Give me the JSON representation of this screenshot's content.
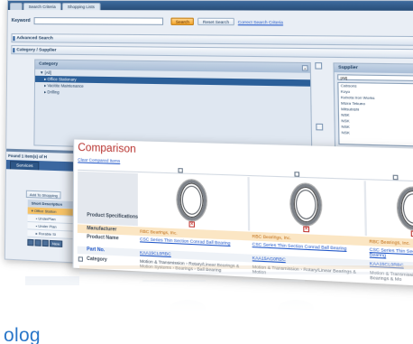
{
  "tabs": [
    "",
    "Search Criteria",
    "Shopping Lists"
  ],
  "search": {
    "keyword_label": "Keyword",
    "keyword_value": "",
    "search_button": "Search",
    "reset_button": "Reset Search",
    "correct_link": "Correct Search Criteria"
  },
  "sections": {
    "advanced": "Advanced Search",
    "category_supplier": "Category / Supplier"
  },
  "category": {
    "header": "Category",
    "items": [
      {
        "label": "▼ [All]",
        "selected": false,
        "indent": false
      },
      {
        "label": "▸ Office Stationary",
        "selected": true,
        "indent": true
      },
      {
        "label": "▸ Vacitite Maintenance",
        "selected": false,
        "indent": true
      },
      {
        "label": "▸ Drilling",
        "selected": false,
        "indent": true
      }
    ]
  },
  "supplier": {
    "header": "Supplier",
    "selected": "[All]",
    "items": [
      "Cabsons",
      "Koyo",
      "Kubota Iron Works",
      "Mizra Tekuno",
      "Mitsubishi",
      "NSK",
      "NSK",
      "NSK",
      "NSK"
    ]
  },
  "results": {
    "found_text": "Found 1 item(s) of H",
    "services_tab": "Services",
    "add_button": "Add To Shopping",
    "list_rows": [
      {
        "label": "Short Description",
        "type": "hd"
      },
      {
        "label": "▾ Office Station",
        "type": "sel"
      },
      {
        "label": "• UnderPlan",
        "type": "ind"
      },
      {
        "label": "• Under Plan",
        "type": "ind"
      },
      {
        "label": "▸ Rorable Si",
        "type": "ind"
      }
    ],
    "new_button": "New"
  },
  "comparison": {
    "title": "Comparison",
    "clear_link": "Clear Compared Items",
    "row_labels": {
      "product_specs": "Product Specifications",
      "manufacturer": "Manufacturer",
      "product_name": "Product Name",
      "part_no": "Part No.",
      "category": "Category"
    },
    "products": [
      {
        "manufacturer": "RBC Bearings, Inc.",
        "product_name": "CSC Series Thin Section Conrad Ball Bearing",
        "part_no": "KAA15CL0RBC",
        "category": "Motion & Transmission › Rotary/Linear Bearings & Motion Systems › Bearings › Ball Bearing"
      },
      {
        "manufacturer": "RBC Bearings, Inc.",
        "product_name": "CSC Series Thin Section Conrad Ball Bearing",
        "part_no": "KAA15AG0RBC",
        "category": "Motion & Transmission › Rotary/Linear Bearings & Motion"
      },
      {
        "manufacturer": "RBC Bearings, Inc.",
        "product_name": "CSC Series Thin Section Conrad Ball Bearing",
        "part_no": "KAA15CL0RBC",
        "category": "Motion & Transmission › Rotary/Linear Bearings & Mo"
      }
    ]
  },
  "bottom_word": "olog",
  "colors": {
    "title_red": "#b8332f",
    "link_blue": "#1f56c8",
    "nav_blue": "#2b5f99",
    "manufacturer_orange": "#c06d14",
    "bottom_blue": "#2a77c9"
  }
}
